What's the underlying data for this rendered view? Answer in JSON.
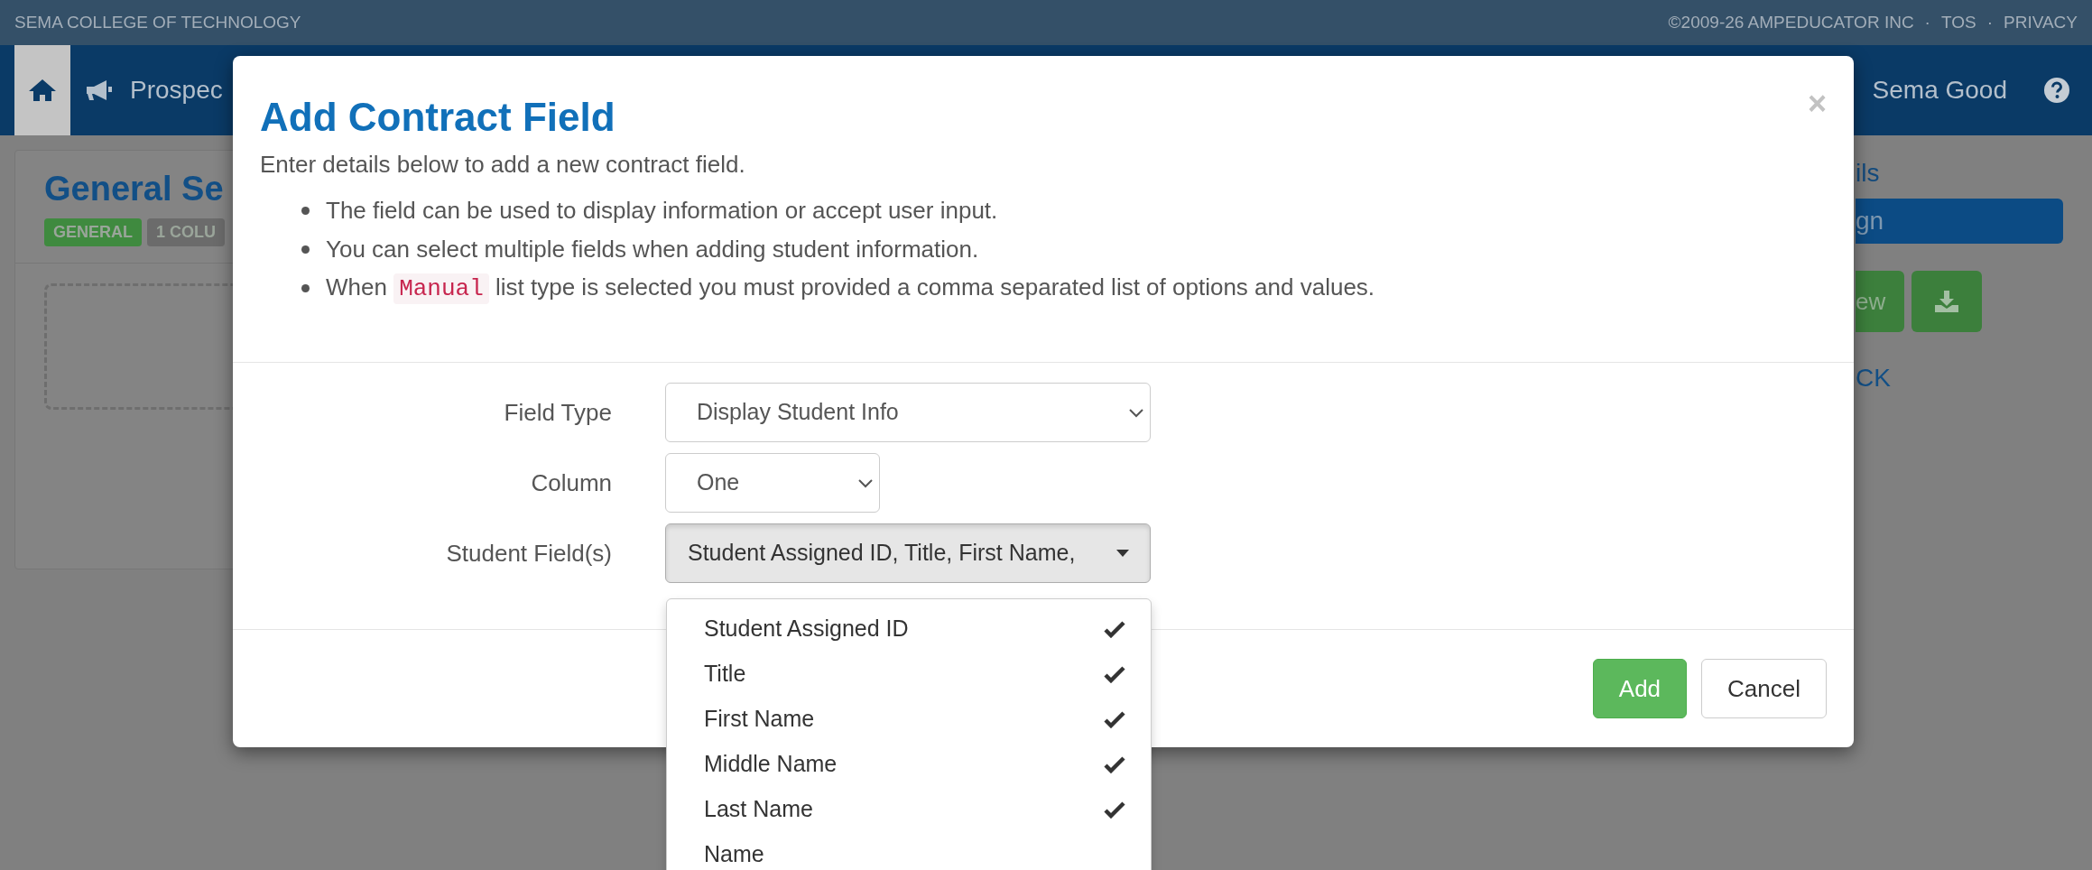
{
  "top_bar": {
    "institution": "SEMA COLLEGE OF TECHNOLOGY",
    "links": [
      "©2009-26 AMPEDUCATOR INC",
      "TOS",
      "PRIVACY"
    ],
    "separator": "·"
  },
  "nav": {
    "home_selected": true,
    "item": "Prospec",
    "user": "Sema Good"
  },
  "page": {
    "title": "General Se",
    "badges": [
      {
        "label": "GENERAL",
        "color": "#3f8a3f"
      },
      {
        "label": "1 COLU",
        "color": "#6b6b6b"
      }
    ]
  },
  "side": {
    "heading": "ils",
    "button": "gn",
    "action": "ew",
    "link": "CK"
  },
  "modal": {
    "title": "Add Contract Field",
    "close": "×",
    "subtitle": "Enter details below to add a new contract field.",
    "bullets": [
      {
        "text": "The field can be used to display information or accept user input."
      },
      {
        "text": "You can select multiple fields when adding student information."
      },
      {
        "prefix": "When",
        "code": "Manual",
        "text": "list type is selected you must provided a comma separated list of options and values."
      }
    ],
    "fields": [
      {
        "label": "Field Type",
        "kind": "select",
        "value": "Display Student Info"
      },
      {
        "label": "Column",
        "kind": "select",
        "value": "One"
      },
      {
        "label": "Student Field(s)",
        "kind": "multiselect",
        "value": "Student Assigned ID, Title, First Name,",
        "expanded": true
      }
    ],
    "options": [
      {
        "label": "Student Assigned ID",
        "checked": true
      },
      {
        "label": "Title",
        "checked": true
      },
      {
        "label": "First Name",
        "checked": true
      },
      {
        "label": "Middle Name",
        "checked": true
      },
      {
        "label": "Last Name",
        "checked": true
      },
      {
        "label": "Name",
        "checked": false
      }
    ],
    "buttons": [
      {
        "label": "Add",
        "kind": "primary"
      },
      {
        "label": "Cancel",
        "kind": "default"
      }
    ]
  }
}
